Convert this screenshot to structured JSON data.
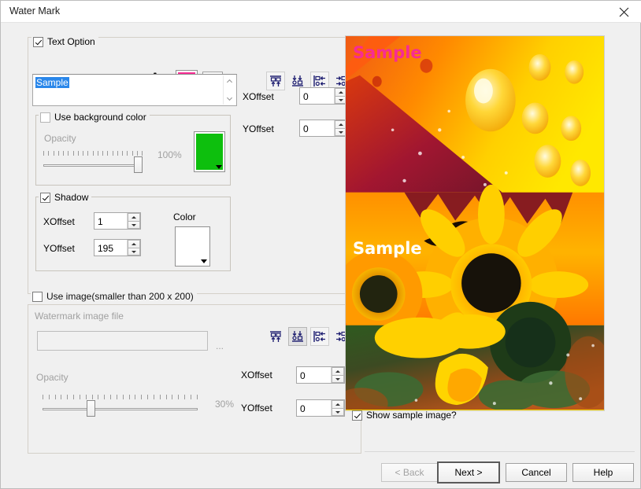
{
  "window": {
    "title": "Water Mark",
    "close_icon": "close-icon"
  },
  "text_option": {
    "label": "Text Option",
    "checked": true,
    "font_sample_glyph": "A",
    "font_color": "#f72c94",
    "more_button_label": ">>",
    "text_value": "Sample",
    "xoffset_label": "XOffset",
    "xoffset_value": "0",
    "yoffset_label": "YOffset",
    "yoffset_value": "0",
    "align_icons": [
      "align-top-icon",
      "align-bottom-icon",
      "align-left-icon",
      "align-right-icon"
    ],
    "align_selected_index": 0
  },
  "background_color": {
    "label": "Use background color",
    "checked": false,
    "opacity_label": "Opacity",
    "opacity_value": "100%",
    "opacity_percent": 100,
    "color": "#0dbf0d"
  },
  "shadow": {
    "label": "Shadow",
    "checked": true,
    "xoffset_label": "XOffset",
    "xoffset_value": "1",
    "yoffset_label": "YOffset",
    "yoffset_value": "195",
    "color_label": "Color",
    "color": "#ffffff"
  },
  "image_option": {
    "label": "Use image(smaller than 200 x 200)",
    "checked": false,
    "file_label": "Watermark image file",
    "file_value": "",
    "browse_label": "...",
    "opacity_label": "Opacity",
    "opacity_value": "30%",
    "opacity_percent": 30,
    "xoffset_label": "XOffset",
    "xoffset_value": "0",
    "yoffset_label": "YOffset",
    "yoffset_value": "0",
    "align_icons": [
      "align-top-icon",
      "align-bottom-icon",
      "align-left-icon",
      "align-right-icon"
    ],
    "align_selected_index": 1
  },
  "preview": {
    "watermark_top_text": "Sample",
    "watermark_top_color": "#f72c94",
    "watermark_shadow_text": "Sample",
    "watermark_shadow_color": "#ffffff",
    "show_sample_label": "Show sample image?",
    "show_sample_checked": true
  },
  "footer": {
    "back_label": "< Back",
    "back_enabled": false,
    "next_label": "Next >",
    "cancel_label": "Cancel",
    "help_label": "Help"
  }
}
